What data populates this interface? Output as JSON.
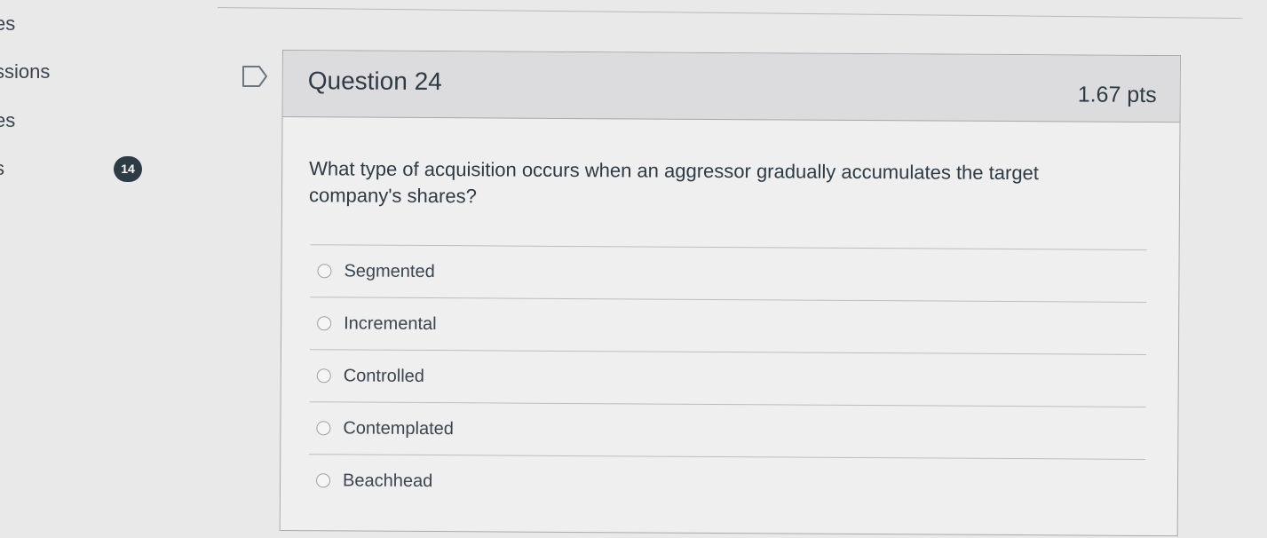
{
  "left_nav": {
    "items": [
      "es",
      "ssions",
      "es",
      "s"
    ],
    "badge_count": "14"
  },
  "question": {
    "title": "Question 24",
    "points": "1.67 pts",
    "text": "What type of acquisition occurs when an aggressor gradually accumulates the target company's shares?",
    "flag_icon": "flag-outline-icon",
    "options": [
      "Segmented",
      "Incremental",
      "Controlled",
      "Contemplated",
      "Beachhead"
    ],
    "selected": null
  },
  "colors": {
    "text": "#2d3b45",
    "badge": "#2d3b45",
    "header_bg": "#dcdcde",
    "card_bg": "#efefef",
    "page_bg": "#e9e9ea"
  }
}
